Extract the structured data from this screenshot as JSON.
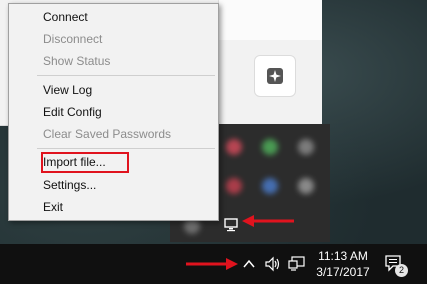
{
  "menu": {
    "items": [
      {
        "label": "Connect",
        "enabled": true
      },
      {
        "label": "Disconnect",
        "enabled": false
      },
      {
        "label": "Show Status",
        "enabled": false
      },
      {
        "label": "View Log",
        "enabled": true
      },
      {
        "label": "Edit Config",
        "enabled": true
      },
      {
        "label": "Clear Saved Passwords",
        "enabled": false
      },
      {
        "label": "Import file...",
        "enabled": true,
        "highlighted": true
      },
      {
        "label": "Settings...",
        "enabled": true
      },
      {
        "label": "Exit",
        "enabled": true
      }
    ]
  },
  "taskbar": {
    "time": "11:13 AM",
    "date": "3/17/2017",
    "notification_count": "2"
  },
  "icons": {
    "action_center_button": "sparkle-icon",
    "overflow_chevron": "chevron-up-icon",
    "volume": "speaker-icon",
    "network": "network-icon",
    "vpn_tray": "vpn-monitor-icon",
    "notifications": "notification-icon"
  },
  "colors": {
    "highlight": "#e0131e",
    "menu_bg": "#f2f2f2",
    "taskbar_bg": "#101010"
  }
}
